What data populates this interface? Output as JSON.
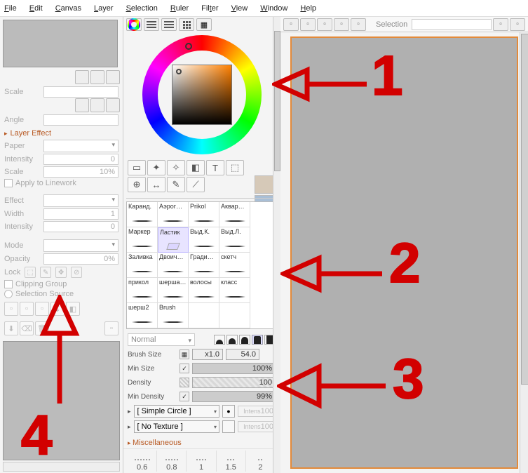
{
  "menu": {
    "items": [
      "File",
      "Edit",
      "Canvas",
      "Layer",
      "Selection",
      "Ruler",
      "Filter",
      "View",
      "Window",
      "Help"
    ]
  },
  "left": {
    "scale_label": "Scale",
    "angle_label": "Angle",
    "layer_effect": "Layer Effect",
    "paper": "Paper",
    "intensity": "Intensity",
    "intensity_val": "0",
    "scale2": "Scale",
    "scale2_val": "10%",
    "apply_linework": "Apply to Linework",
    "effect": "Effect",
    "width": "Width",
    "width_val": "1",
    "intensity2": "Intensity",
    "intensity2_val": "0",
    "mode": "Mode",
    "opacity": "Opacity",
    "opacity_val": "0%",
    "lock": "Lock",
    "clipping_group": "Clipping Group",
    "selection_source": "Selection Source"
  },
  "tool_icons": [
    "▭",
    "✦",
    "✧",
    "◧",
    "T",
    "⬚",
    "⊕",
    "↔",
    "✎",
    "⟋"
  ],
  "swatch_colors": [
    "#d6c9b8",
    "#a9bfd6"
  ],
  "brushes": [
    {
      "label": "Каранд."
    },
    {
      "label": "Аэрог…"
    },
    {
      "label": "Prikol"
    },
    {
      "label": "Аквар…"
    },
    {
      "label": "Маркер"
    },
    {
      "label": "Ластик",
      "eraser": true,
      "selected": true
    },
    {
      "label": "Выд.К."
    },
    {
      "label": "Выд.Л."
    },
    {
      "label": "Заливка"
    },
    {
      "label": "Двоич…"
    },
    {
      "label": "Гради…"
    },
    {
      "label": "скетч"
    },
    {
      "label": "прикол"
    },
    {
      "label": "шерша…"
    },
    {
      "label": "волосы"
    },
    {
      "label": "класс"
    },
    {
      "label": "шерш2"
    },
    {
      "label": "Brush"
    },
    {
      "label": ""
    },
    {
      "label": ""
    }
  ],
  "blend_mode": "Normal",
  "settings": {
    "brush_size_label": "Brush Size",
    "brush_mult": "x1.0",
    "brush_val": "54.0",
    "min_size_label": "Min Size",
    "min_size_val": "100%",
    "density_label": "Density",
    "density_val": "100",
    "min_density_label": "Min Density",
    "min_density_val": "99%",
    "shape": "[ Simple Circle ]",
    "shape_intensity": "100",
    "texture": "[ No Texture ]",
    "texture_intensity": "100",
    "misc": "Miscellaneous",
    "spacings": [
      "0.6",
      "0.8",
      "1",
      "1.5",
      "2"
    ]
  },
  "doc": {
    "selection_label": "Selection"
  },
  "annotations": {
    "n1": "1",
    "n2": "2",
    "n3": "3",
    "n4": "4"
  }
}
